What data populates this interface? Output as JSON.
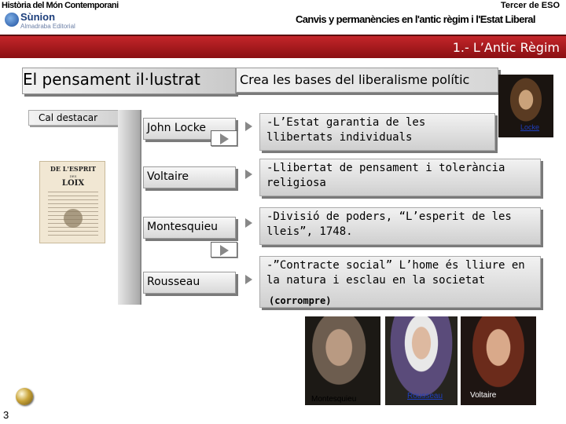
{
  "header": {
    "left_title": "Història del Món Contemporani",
    "right_title": "Tercer de ESO",
    "subtitle": "Canvis y permanències en l'antic règim i l'Estat Liberal",
    "logo_name": "Sùnion",
    "logo_sub": "Almadraba Editorial",
    "section_title": "1.- L’Antic Règim"
  },
  "main": {
    "heading": "El pensament il·lustrat",
    "subheading": "Crea les bases del liberalisme polític",
    "cal_destacar": "Cal destacar",
    "book_title": "DE L'ESPRIT",
    "book_des": "DES",
    "book_loix": "LOIX",
    "thinkers": [
      {
        "name": "John Locke",
        "desc": "-L’Estat garantia de les llibertats individuals"
      },
      {
        "name": "Voltaire",
        "desc": "-Llibertat de pensament i tolerància religiosa"
      },
      {
        "name": "Montesquieu",
        "desc": "-Divisió de poders, “L’esperit de les lleis”, 1748."
      },
      {
        "name": "Rousseau",
        "desc": "-”Contracte social” L’home és lliure en la natura i esclau en la societat"
      }
    ],
    "corrompre": "(corrompre)",
    "locke_caption": "Locke",
    "photos": {
      "montesquieu": "Montesquieu",
      "rousseau": "Rousseau",
      "voltaire": "Voltaire"
    }
  },
  "footer": {
    "page_number": "3"
  },
  "colors": {
    "accent_red": "#b01c20",
    "link_blue": "#1f3fc0"
  }
}
